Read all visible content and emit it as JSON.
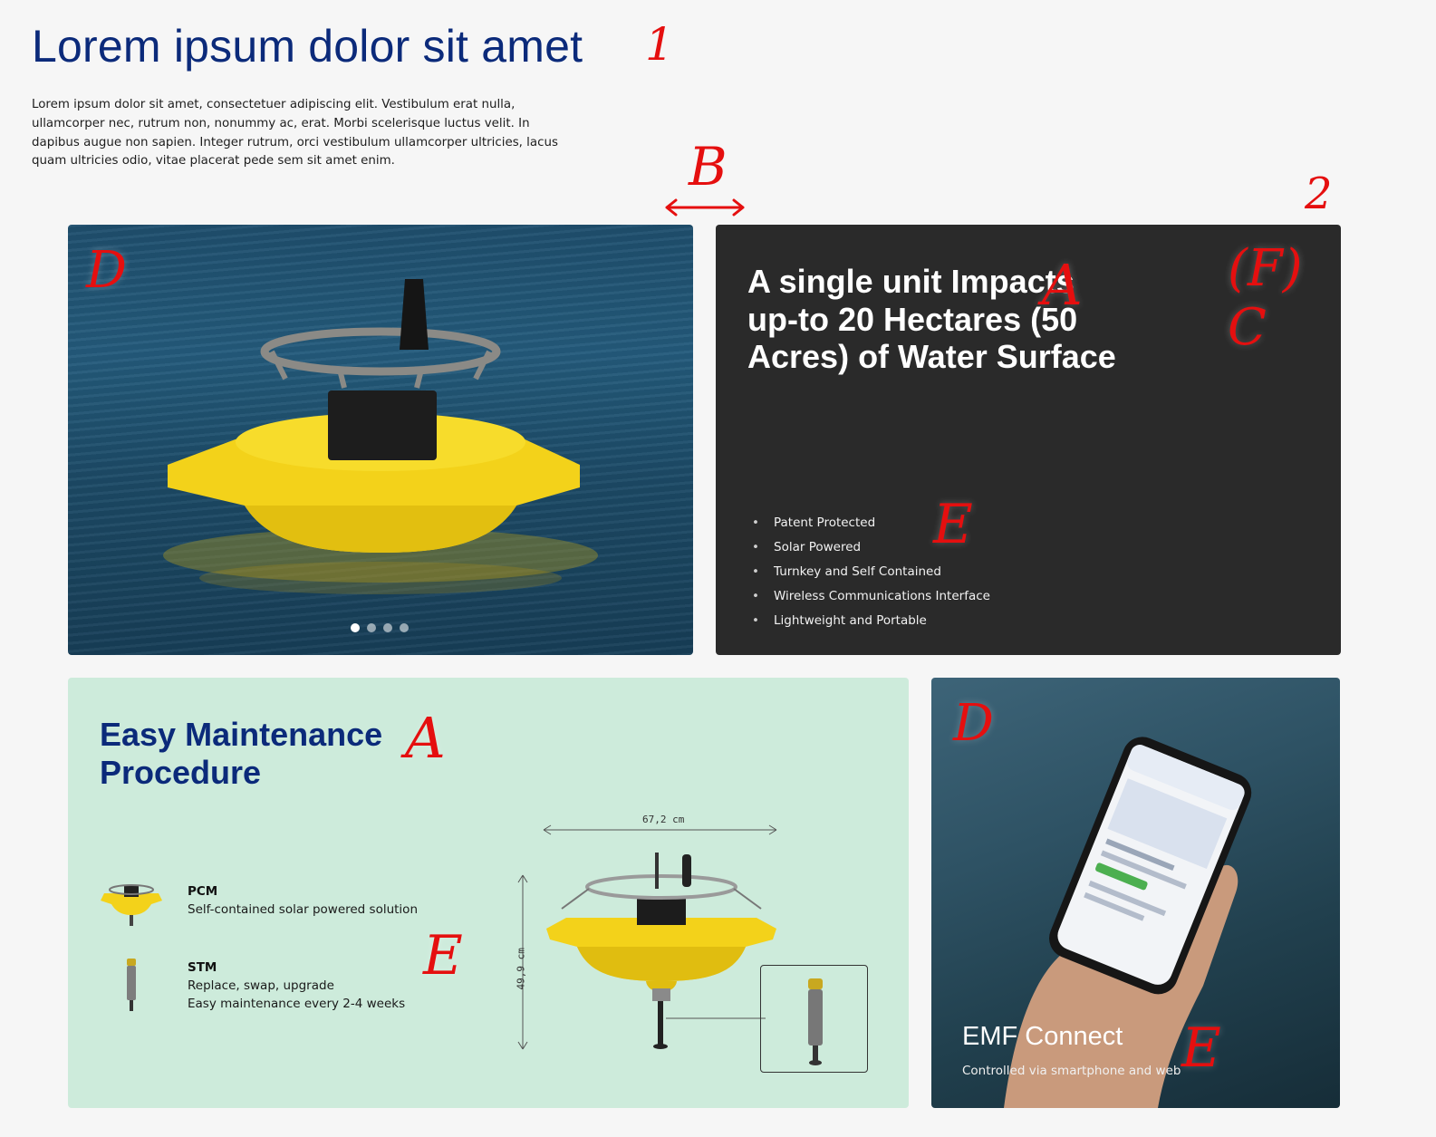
{
  "page": {
    "title": "Lorem ipsum dolor sit amet",
    "intro": "Lorem ipsum dolor sit amet, consectetuer adipiscing elit. Vestibulum erat nulla, ullamcorper nec, rutrum non, nonummy ac, erat. Morbi scelerisque luctus velit. In dapibus augue non sapien. Integer rutrum, orci vestibulum ullamcorper ultricies, lacus quam ultricies odio, vitae placerat pede sem sit amet enim."
  },
  "annotations": {
    "one": "1",
    "two": "2",
    "b": "B",
    "a1": "A",
    "a2": "A",
    "fc": "(F) C",
    "d1": "D",
    "d2": "D",
    "e1": "E",
    "e2": "E",
    "e3": "E"
  },
  "photo_card": {
    "slides": 4,
    "active_slide": 1
  },
  "dark_card": {
    "heading": "A single unit Impacts up-to 20 Hectares (50 Acres) of Water Surface",
    "features": [
      "Patent Protected",
      "Solar Powered",
      "Turnkey and Self Contained",
      "Wireless Communications Interface",
      "Lightweight and Portable"
    ]
  },
  "maintenance_card": {
    "heading": "Easy Maintenance Procedure",
    "items": [
      {
        "title": "PCM",
        "lines": [
          "Self-contained solar powered solution"
        ]
      },
      {
        "title": "STM",
        "lines": [
          "Replace, swap, upgrade",
          "Easy maintenance every 2-4 weeks"
        ]
      }
    ],
    "width_label": "67,2  cm",
    "height_label": "49,9  cm"
  },
  "phone_card": {
    "title": "EMF Connect",
    "subtitle": "Controlled via smartphone and web"
  },
  "colors": {
    "brand_blue": "#0b2a7a",
    "buoy_yellow": "#f3d21a",
    "annotation_red": "#e50f0f",
    "dark_card": "#2a2a2a",
    "mint": "#cdebdb"
  }
}
